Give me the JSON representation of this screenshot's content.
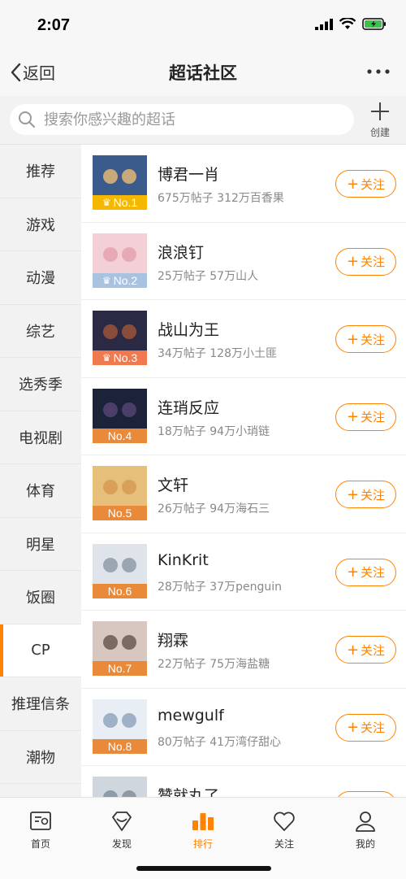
{
  "status": {
    "time": "2:07"
  },
  "nav": {
    "back_label": "返回",
    "title": "超话社区"
  },
  "search": {
    "placeholder": "搜索你感兴趣的超话",
    "create_label": "创建"
  },
  "sidebar": {
    "items": [
      {
        "label": "推荐"
      },
      {
        "label": "游戏"
      },
      {
        "label": "动漫"
      },
      {
        "label": "综艺"
      },
      {
        "label": "选秀季"
      },
      {
        "label": "电视剧"
      },
      {
        "label": "体育"
      },
      {
        "label": "明星"
      },
      {
        "label": "饭圈"
      },
      {
        "label": "CP"
      },
      {
        "label": "推理信条"
      },
      {
        "label": "潮物"
      }
    ],
    "active": "CP"
  },
  "ranking": {
    "follow_label": "关注",
    "items": [
      {
        "rank": "No.1",
        "name": "博君一肖",
        "stats": "675万帖子 312万百香果",
        "badge_color": "#f5b800",
        "crown": true
      },
      {
        "rank": "No.2",
        "name": "浪浪钉",
        "stats": "25万帖子 57万山人",
        "badge_color": "#a9c2e0",
        "crown": true
      },
      {
        "rank": "No.3",
        "name": "战山为王",
        "stats": "34万帖子 128万小土匪",
        "badge_color": "#f07a50",
        "crown": true
      },
      {
        "rank": "No.4",
        "name": "连琑反应",
        "stats": "18万帖子 94万小琑链",
        "badge_color": "#e98a3a",
        "crown": false
      },
      {
        "rank": "No.5",
        "name": "文轩",
        "stats": "26万帖子 94万海石三",
        "badge_color": "#e98a3a",
        "crown": false
      },
      {
        "rank": "No.6",
        "name": "KinKrit",
        "stats": "28万帖子 37万penguin",
        "badge_color": "#e98a3a",
        "crown": false
      },
      {
        "rank": "No.7",
        "name": "翔霖",
        "stats": "22万帖子 75万海盐糖",
        "badge_color": "#e98a3a",
        "crown": false
      },
      {
        "rank": "No.8",
        "name": "mewgulf",
        "stats": "80万帖子 41万湾仔甜心",
        "badge_color": "#e98a3a",
        "crown": false
      },
      {
        "rank": "",
        "name": "赞就丸了",
        "stats": "",
        "badge_color": "#e98a3a",
        "crown": false
      }
    ]
  },
  "tabs": [
    {
      "label": "首页",
      "icon": "home-icon"
    },
    {
      "label": "发现",
      "icon": "discover-icon"
    },
    {
      "label": "排行",
      "icon": "ranking-icon",
      "active": true
    },
    {
      "label": "关注",
      "icon": "heart-icon"
    },
    {
      "label": "我的",
      "icon": "profile-icon"
    }
  ],
  "colors": {
    "accent": "#ff8200"
  }
}
